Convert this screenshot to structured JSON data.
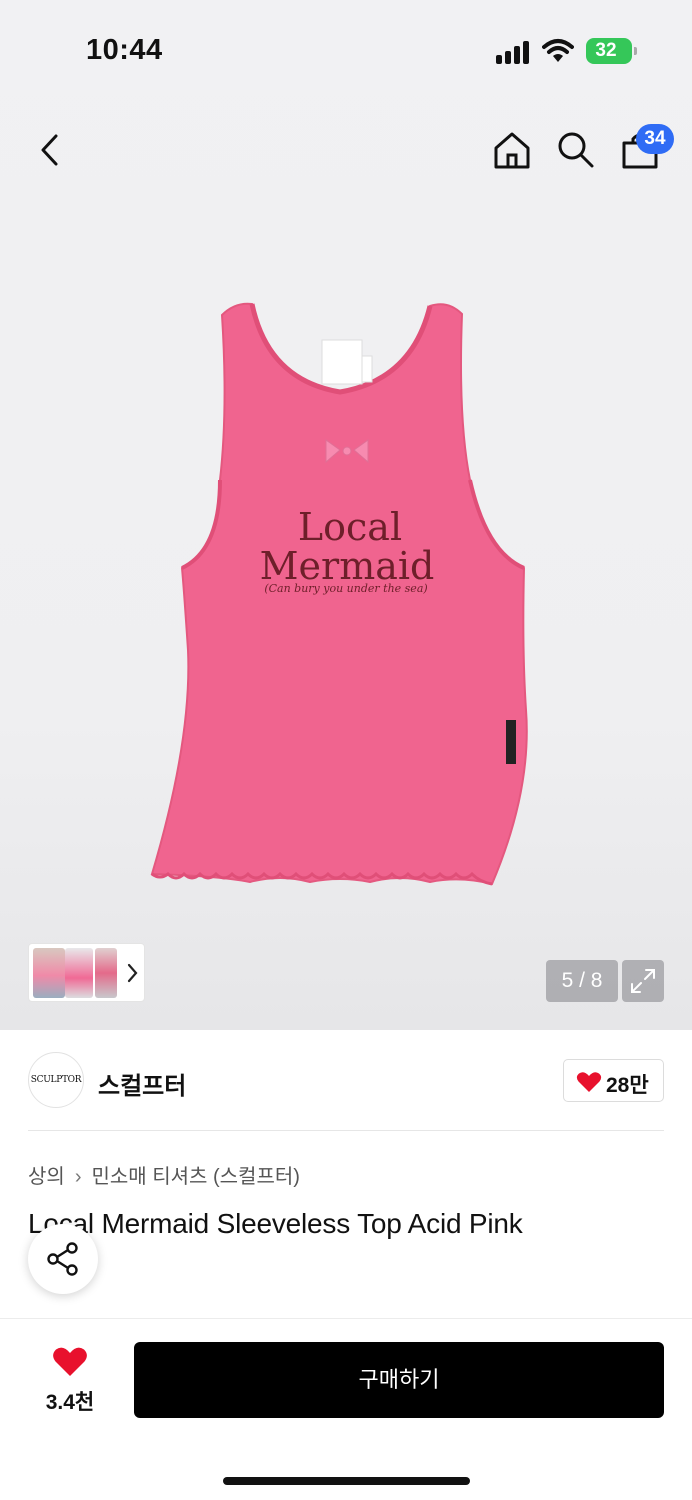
{
  "status_bar": {
    "time": "10:44",
    "battery": "32"
  },
  "nav": {
    "back_icon": "chevron-left-icon",
    "home_icon": "home-icon",
    "search_icon": "search-icon",
    "cart_icon": "shopping-bag-icon",
    "cart_badge": "34"
  },
  "gallery": {
    "graphic_line1": "Local",
    "graphic_line2": "Mermaid",
    "graphic_line3": "(Can bury you under the sea)",
    "page_counter": "5 / 8",
    "expand_icon": "expand-icon",
    "thumb_arrow_icon": "chevron-right-icon"
  },
  "brand": {
    "logo_text": "SCULPTOR",
    "name": "스컬프터",
    "likes": "28만",
    "like_icon": "heart-icon"
  },
  "breadcrumb": {
    "category": "상의",
    "subcategory": "민소매 티셔츠 (스컬프터)"
  },
  "product": {
    "title": "Local Mermaid Sleeveless Top Acid Pink"
  },
  "share_icon": "share-icon",
  "bottom": {
    "wish_count": "3.4천",
    "buy_label": "구매하기"
  },
  "colors": {
    "accent_badge": "#2f6cf5",
    "heart": "#e8112d",
    "top_pink": "#f0648f",
    "buy_button": "#000000"
  }
}
